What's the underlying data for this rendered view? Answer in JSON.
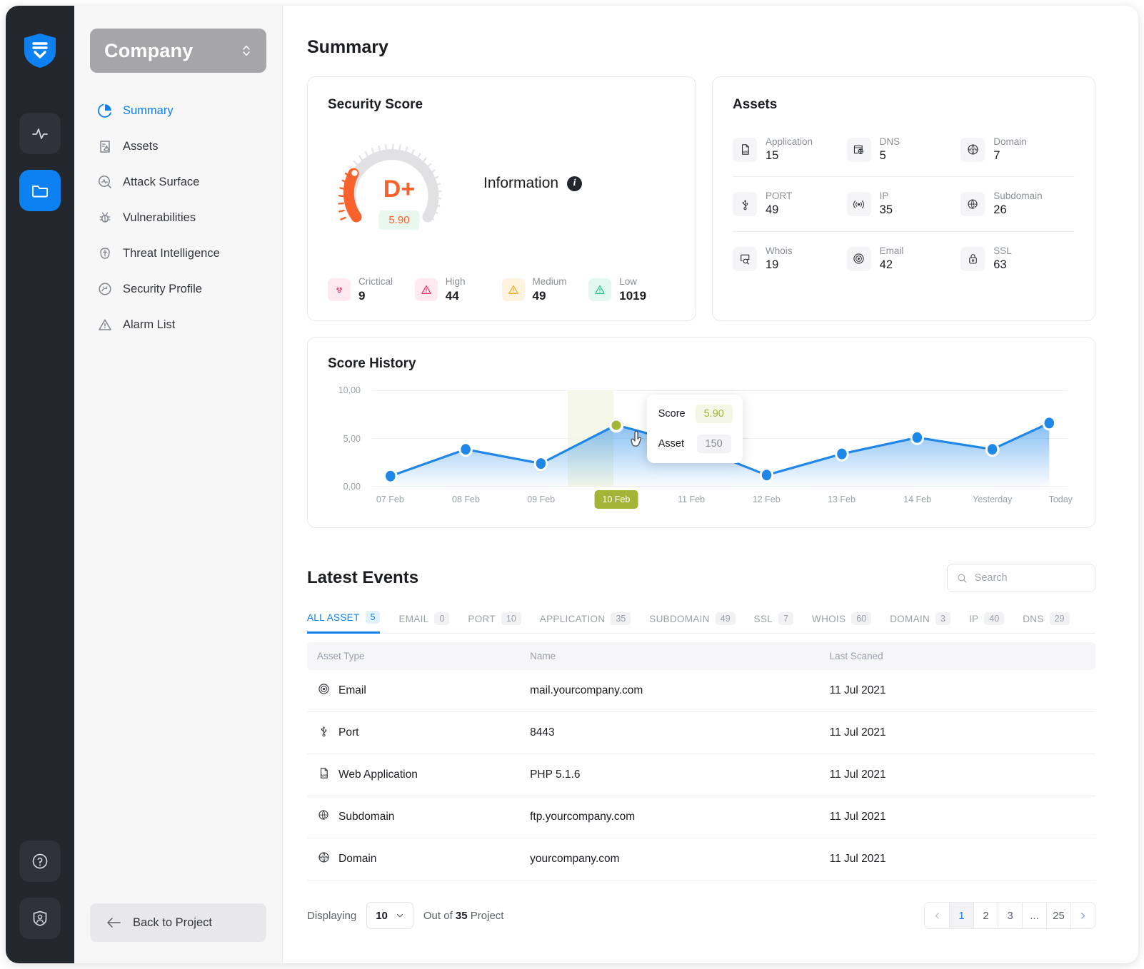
{
  "rail": {
    "logo": "shield-logo",
    "buttons": [
      {
        "icon": "activity-pulse-icon",
        "active": false
      },
      {
        "icon": "folder-icon",
        "active": true
      }
    ],
    "bottom_buttons": [
      {
        "icon": "help-circle-icon"
      },
      {
        "icon": "user-shield-icon"
      }
    ]
  },
  "sidebar": {
    "company": "Company",
    "items": [
      {
        "label": "Summary",
        "icon": "pie-chart-icon",
        "active": true
      },
      {
        "label": "Assets",
        "icon": "clipboard-alert-icon",
        "active": false
      },
      {
        "label": "Attack Surface",
        "icon": "search-pulse-icon",
        "active": false
      },
      {
        "label": "Vulnerabilities",
        "icon": "bug-icon",
        "active": false
      },
      {
        "label": "Threat Intelligence",
        "icon": "brain-icon",
        "active": false
      },
      {
        "label": "Security Profile",
        "icon": "gauge-face-icon",
        "active": false
      },
      {
        "label": "Alarm List",
        "icon": "warning-triangle-icon",
        "active": false
      }
    ],
    "back_button": "Back to Project"
  },
  "page": {
    "title": "Summary"
  },
  "security_score": {
    "title": "Security Score",
    "grade": "D+",
    "value": "5.90",
    "information_label": "Information",
    "severities": [
      {
        "name": "Crictical",
        "count": "9",
        "color": "#f2336b",
        "bg": "#fde9ef",
        "icon": "radiation-icon"
      },
      {
        "name": "High",
        "count": "44",
        "color": "#f2336b",
        "bg": "#fde9ef",
        "icon": "alert-triangle-icon"
      },
      {
        "name": "Medium",
        "count": "49",
        "color": "#f8a927",
        "bg": "#fef3df",
        "icon": "alert-triangle-icon"
      },
      {
        "name": "Low",
        "count": "1019",
        "color": "#27c08a",
        "bg": "#e2f7ef",
        "icon": "alert-triangle-icon"
      }
    ]
  },
  "assets": {
    "title": "Assets",
    "rows": [
      [
        {
          "name": "Application",
          "count": "15",
          "icon": "app-file-icon"
        },
        {
          "name": "DNS",
          "count": "5",
          "icon": "dns-browser-icon"
        },
        {
          "name": "Domain",
          "count": "7",
          "icon": "www-globe-icon"
        }
      ],
      [
        {
          "name": "PORT",
          "count": "49",
          "icon": "usb-port-icon"
        },
        {
          "name": "IP",
          "count": "35",
          "icon": "broadcast-icon"
        },
        {
          "name": "Subdomain",
          "count": "26",
          "icon": "globe-pointer-icon"
        }
      ],
      [
        {
          "name": "Whois",
          "count": "19",
          "icon": "whois-search-icon"
        },
        {
          "name": "Email",
          "count": "42",
          "icon": "at-sign-icon"
        },
        {
          "name": "SSL",
          "count": "63",
          "icon": "lock-icon"
        }
      ]
    ]
  },
  "chart_data": {
    "type": "line",
    "title": "Score History",
    "xlabel": "",
    "ylabel": "",
    "ylim": [
      0,
      10
    ],
    "ytick_labels": [
      "0,00",
      "5,00",
      "10,00"
    ],
    "yticks": [
      0,
      5,
      10
    ],
    "grid": true,
    "legend": "none",
    "categories": [
      "07 Feb",
      "08 Feb",
      "09 Feb",
      "10 Feb",
      "11 Feb",
      "12 Feb",
      "13 Feb",
      "14 Feb",
      "Yesterday",
      "Today"
    ],
    "series": [
      {
        "name": "Score",
        "values": [
          1.1,
          3.5,
          2.4,
          6.4,
          4.3,
          1.2,
          3.4,
          5.1,
          3.5,
          6.6
        ]
      }
    ],
    "selected_index": 3,
    "selected_category": "10 Feb",
    "tooltip": {
      "score_label": "Score",
      "score_value": "5.90",
      "asset_label": "Asset",
      "asset_value": "150"
    },
    "colors": {
      "line": "#1f87e8",
      "point": "#1f87e8",
      "highlight": "#a2b536"
    }
  },
  "latest_events": {
    "title": "Latest Events",
    "search_placeholder": "Search",
    "search_value": "",
    "tabs": [
      {
        "label": "ALL ASSET",
        "count": "5",
        "active": true
      },
      {
        "label": "EMAIL",
        "count": "0",
        "active": false
      },
      {
        "label": "PORT",
        "count": "10",
        "active": false
      },
      {
        "label": "APPLICATION",
        "count": "35",
        "active": false
      },
      {
        "label": "SUBDOMAIN",
        "count": "49",
        "active": false
      },
      {
        "label": "SSL",
        "count": "7",
        "active": false
      },
      {
        "label": "WHOIS",
        "count": "60",
        "active": false
      },
      {
        "label": "DOMAIN",
        "count": "3",
        "active": false
      },
      {
        "label": "IP",
        "count": "40",
        "active": false
      },
      {
        "label": "DNS",
        "count": "29",
        "active": false
      }
    ],
    "columns": [
      "Asset Type",
      "Name",
      "Last Scaned"
    ],
    "rows": [
      {
        "type": "Email",
        "icon": "at-sign-icon",
        "name": "mail.yourcompany.com",
        "scanned": "11 Jul 2021"
      },
      {
        "type": "Port",
        "icon": "usb-port-icon",
        "name": "8443",
        "scanned": "11 Jul 2021"
      },
      {
        "type": "Web Application",
        "icon": "app-file-icon",
        "name": "PHP 5.1.6",
        "scanned": "11 Jul 2021"
      },
      {
        "type": "Subdomain",
        "icon": "globe-pointer-icon",
        "name": "ftp.yourcompany.com",
        "scanned": "11 Jul 2021"
      },
      {
        "type": "Domain",
        "icon": "www-globe-icon",
        "name": "yourcompany.com",
        "scanned": "11 Jul 2021"
      }
    ]
  },
  "footer": {
    "displaying_label": "Displaying",
    "page_size": "10",
    "out_of_prefix": "Out of",
    "total": "35",
    "out_of_suffix": "Project",
    "pages": [
      "1",
      "2",
      "3",
      "...",
      "25"
    ],
    "current_page": "1"
  }
}
